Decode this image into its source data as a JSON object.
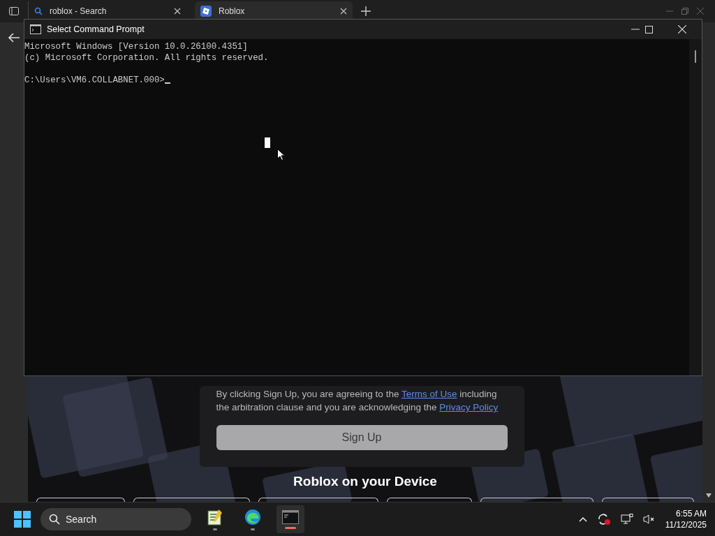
{
  "browser": {
    "tabs": [
      {
        "title": "roblox - Search",
        "kind": "search",
        "selected": false
      },
      {
        "title": "Roblox",
        "kind": "site",
        "selected": true
      }
    ],
    "page": {
      "terms_before": "By clicking Sign Up, you are agreeing to the",
      "terms_link": "Terms of Use",
      "terms_middle": "including the arbitration clause and you are acknowledging the",
      "privacy_link": "Privacy Policy",
      "signup_button": {
        "label": "Sign Up",
        "disabled": true
      },
      "heading": "Roblox on your Device"
    }
  },
  "console": {
    "title": "Select Command Prompt",
    "lines": [
      "Microsoft Windows [Version 10.0.26100.4351]",
      "(c) Microsoft Corporation. All rights reserved."
    ],
    "prompt": "C:\\Users\\VM6.COLLABNET.000>"
  },
  "taskbar": {
    "search_placeholder": "Search",
    "apps": [
      {
        "kind": "notepad",
        "selected": false
      },
      {
        "kind": "edge",
        "selected": false
      },
      {
        "kind": "terminal",
        "selected": true
      }
    ],
    "time": "6:55 AM",
    "date": "11/12/2025"
  }
}
